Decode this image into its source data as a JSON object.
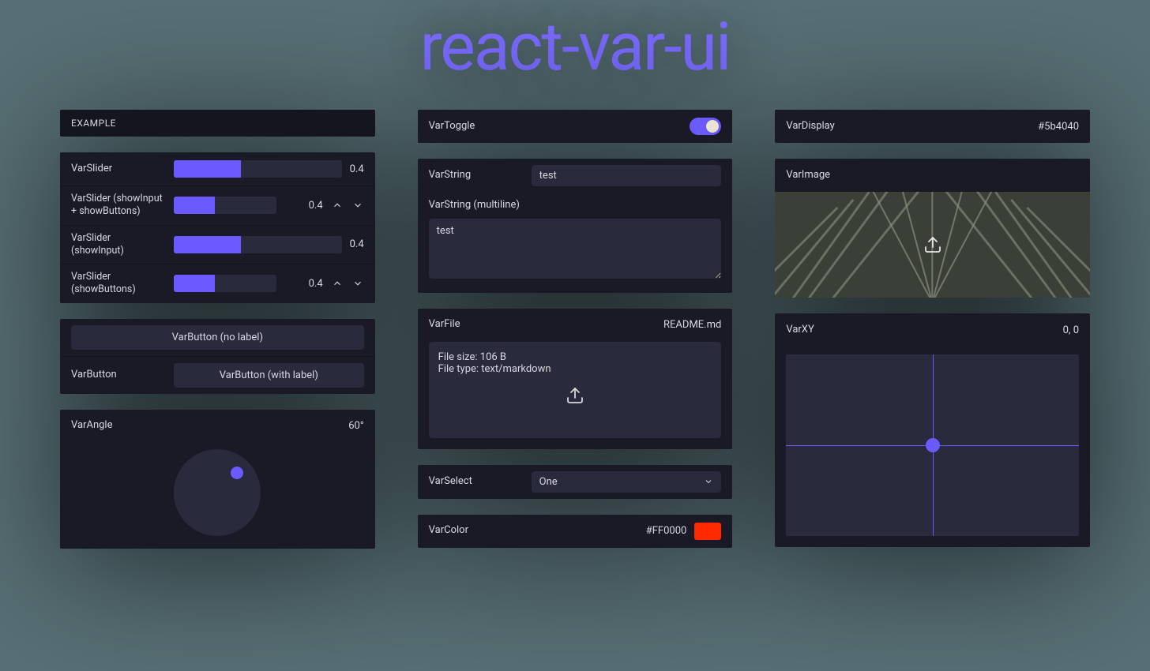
{
  "title": "react-var-ui",
  "colors": {
    "accent": "#6b5aff",
    "panel": "#1a1a27",
    "field": "#2a2a3d"
  },
  "example": {
    "header": "EXAMPLE"
  },
  "sliders": {
    "s1": {
      "label": "VarSlider",
      "value": "0.4"
    },
    "s2": {
      "label": "VarSlider (showInput + showButtons)",
      "value": "0.4"
    },
    "s3": {
      "label": "VarSlider (showInput)",
      "value": "0.4"
    },
    "s4": {
      "label": "VarSlider (showButtons)",
      "value": "0.4"
    }
  },
  "buttons": {
    "no_label": "VarButton (no label)",
    "with_label_name": "VarButton",
    "with_label_text": "VarButton (with label)"
  },
  "angle": {
    "label": "VarAngle",
    "value": "60°"
  },
  "toggle": {
    "label": "VarToggle",
    "value": true
  },
  "string": {
    "label": "VarString",
    "value": "test"
  },
  "multiline": {
    "label": "VarString (multiline)",
    "value": "test"
  },
  "file": {
    "label": "VarFile",
    "name": "README.md",
    "size_line": "File size: 106 B",
    "type_line": "File type: text/markdown"
  },
  "select": {
    "label": "VarSelect",
    "value": "One"
  },
  "color": {
    "label": "VarColor",
    "value": "#FF0000"
  },
  "display": {
    "label": "VarDisplay",
    "value": "#5b4040"
  },
  "image": {
    "label": "VarImage"
  },
  "xy": {
    "label": "VarXY",
    "value": "0, 0"
  }
}
